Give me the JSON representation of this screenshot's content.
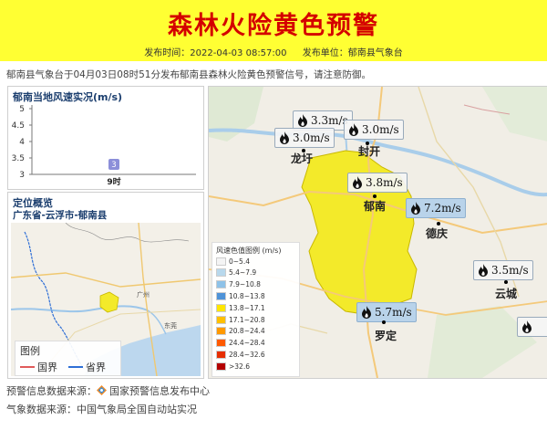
{
  "header": {
    "title": "森林火险黄色预警",
    "publish_time": "发布时间：2022-04-03 08:57:00",
    "publisher": "发布单位：郁南县气象台"
  },
  "summary": "郁南县气象台于04月03日08时51分发布郁南县森林火险黄色预警信号，请注意防御。",
  "wind_chart": {
    "title": "郁南当地风速实况(m/s)",
    "chart_data": {
      "type": "bar",
      "title": "郁南当地风速实况(m/s)",
      "categories": [
        "9时"
      ],
      "values": [
        3
      ],
      "ylim": [
        3,
        5
      ],
      "yticks": [
        "5",
        "4.5",
        "4",
        "3.5",
        "3"
      ],
      "data_labels": [
        "3"
      ],
      "bar_color": "#8c8fd9"
    }
  },
  "location": {
    "title": "定位概览",
    "path": "广东省-云浮市-郁南县",
    "legend_title": "图例",
    "legend": [
      {
        "label": "国界",
        "color": "#e05a5a"
      },
      {
        "label": "省界",
        "color": "#2f6fd6"
      }
    ],
    "map_labels": [
      "广州",
      "东莞"
    ]
  },
  "map": {
    "legend_title": "风速色值图例 (m/s)",
    "legend": [
      {
        "label": "0~5.4",
        "color": "#f4f4f4"
      },
      {
        "label": "5.4~7.9",
        "color": "#b8d8ec"
      },
      {
        "label": "7.9~10.8",
        "color": "#8ec2e8"
      },
      {
        "label": "10.8~13.8",
        "color": "#4f93d8"
      },
      {
        "label": "13.8~17.1",
        "color": "#ffe600"
      },
      {
        "label": "17.1~20.8",
        "color": "#ffc000"
      },
      {
        "label": "20.8~24.4",
        "color": "#ff9900"
      },
      {
        "label": "24.4~28.4",
        "color": "#ff5a00"
      },
      {
        "label": "28.4~32.6",
        "color": "#e62e00"
      },
      {
        "label": ">32.6",
        "color": "#b30000"
      }
    ],
    "stations": [
      {
        "value": "3.3m/s",
        "style": "gray"
      },
      {
        "value": "3.0m/s",
        "style": "gray"
      },
      {
        "value": "3.0m/s",
        "style": "gray"
      },
      {
        "value": "3.8m/s",
        "style": "gray"
      },
      {
        "value": "7.2m/s",
        "style": "blue"
      },
      {
        "value": "3.5m/s",
        "style": "gray"
      },
      {
        "value": "5.7m/s",
        "style": "blue"
      }
    ],
    "cities": [
      "龙圩",
      "封开",
      "郁南",
      "德庆",
      "云城",
      "罗定"
    ]
  },
  "footer": {
    "warning_source": "预警信息数据来源：",
    "warning_source_name": "国家预警信息发布中心",
    "weather_source": "气象数据来源：中国气象局全国自动站实况"
  },
  "colors": {
    "banner": "#ffff33",
    "title": "#d40000",
    "warning_area": "#f3ea2a"
  }
}
